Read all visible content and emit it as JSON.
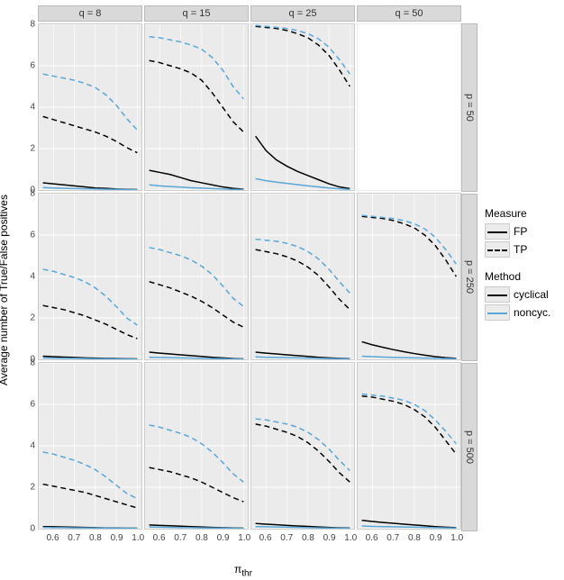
{
  "ylabel": "Average number of True/False positives",
  "xlabel": "π_thr",
  "x_ticks": [
    0.6,
    0.7,
    0.8,
    0.9,
    1.0
  ],
  "y_range": [
    0,
    8
  ],
  "y_ticks": [
    0,
    2,
    4,
    6,
    8
  ],
  "cols": [
    "q = 8",
    "q = 15",
    "q = 25",
    "q = 50"
  ],
  "rows": [
    "p = 50",
    "p = 250",
    "p = 500"
  ],
  "legend": {
    "measure_title": "Measure",
    "measure_items": [
      {
        "key": "FP",
        "label": "FP",
        "dash": false
      },
      {
        "key": "TP",
        "label": "TP",
        "dash": true
      }
    ],
    "method_title": "Method",
    "method_items": [
      {
        "key": "cyclical",
        "label": "cyclical",
        "color": "#000000"
      },
      {
        "key": "noncyc",
        "label": "noncyc.",
        "color": "#58a7d6"
      }
    ]
  },
  "chart_data": {
    "type": "line-grid",
    "x": [
      0.55,
      0.6,
      0.65,
      0.7,
      0.75,
      0.8,
      0.85,
      0.9,
      0.95,
      1.0
    ],
    "xlim": [
      0.53,
      1.02
    ],
    "ylim": [
      0,
      8
    ],
    "panels": [
      [
        {
          "q": 8,
          "p": 50,
          "series": [
            {
              "method": "cyclical",
              "measure": "TP",
              "y": [
                3.55,
                3.4,
                3.25,
                3.1,
                2.95,
                2.8,
                2.6,
                2.35,
                2.05,
                1.8
              ]
            },
            {
              "method": "noncyc",
              "measure": "TP",
              "y": [
                5.6,
                5.5,
                5.4,
                5.3,
                5.15,
                4.95,
                4.6,
                4.1,
                3.45,
                2.9
              ]
            },
            {
              "method": "cyclical",
              "measure": "FP",
              "y": [
                0.35,
                0.3,
                0.25,
                0.2,
                0.15,
                0.1,
                0.08,
                0.05,
                0.03,
                0.02
              ]
            },
            {
              "method": "noncyc",
              "measure": "FP",
              "y": [
                0.12,
                0.1,
                0.08,
                0.07,
                0.06,
                0.05,
                0.04,
                0.03,
                0.02,
                0.01
              ]
            }
          ]
        },
        {
          "q": 15,
          "p": 50,
          "series": [
            {
              "method": "cyclical",
              "measure": "TP",
              "y": [
                6.25,
                6.15,
                6.0,
                5.85,
                5.65,
                5.3,
                4.7,
                4.0,
                3.3,
                2.8
              ]
            },
            {
              "method": "noncyc",
              "measure": "TP",
              "y": [
                7.4,
                7.35,
                7.25,
                7.15,
                7.0,
                6.8,
                6.4,
                5.8,
                5.0,
                4.4
              ]
            },
            {
              "method": "cyclical",
              "measure": "FP",
              "y": [
                0.95,
                0.85,
                0.75,
                0.6,
                0.45,
                0.35,
                0.25,
                0.15,
                0.08,
                0.04
              ]
            },
            {
              "method": "noncyc",
              "measure": "FP",
              "y": [
                0.25,
                0.2,
                0.17,
                0.14,
                0.11,
                0.09,
                0.07,
                0.05,
                0.03,
                0.02
              ]
            }
          ]
        },
        {
          "q": 25,
          "p": 50,
          "series": [
            {
              "method": "cyclical",
              "measure": "TP",
              "y": [
                7.9,
                7.85,
                7.8,
                7.7,
                7.55,
                7.35,
                7.0,
                6.5,
                5.8,
                5.0
              ]
            },
            {
              "method": "noncyc",
              "measure": "TP",
              "y": [
                7.95,
                7.9,
                7.85,
                7.8,
                7.7,
                7.55,
                7.3,
                6.9,
                6.3,
                5.6
              ]
            },
            {
              "method": "cyclical",
              "measure": "FP",
              "y": [
                2.6,
                1.9,
                1.45,
                1.15,
                0.9,
                0.7,
                0.5,
                0.3,
                0.15,
                0.07
              ]
            },
            {
              "method": "noncyc",
              "measure": "FP",
              "y": [
                0.55,
                0.45,
                0.38,
                0.32,
                0.26,
                0.2,
                0.15,
                0.1,
                0.06,
                0.03
              ]
            }
          ]
        },
        {
          "q": 50,
          "p": 50,
          "blank": true
        }
      ],
      [
        {
          "q": 8,
          "p": 250,
          "series": [
            {
              "method": "cyclical",
              "measure": "TP",
              "y": [
                2.6,
                2.5,
                2.4,
                2.25,
                2.1,
                1.9,
                1.7,
                1.45,
                1.2,
                1.0
              ]
            },
            {
              "method": "noncyc",
              "measure": "TP",
              "y": [
                4.35,
                4.25,
                4.1,
                3.95,
                3.75,
                3.45,
                3.05,
                2.55,
                2.0,
                1.65
              ]
            },
            {
              "method": "cyclical",
              "measure": "FP",
              "y": [
                0.15,
                0.13,
                0.11,
                0.09,
                0.07,
                0.06,
                0.05,
                0.04,
                0.03,
                0.02
              ]
            },
            {
              "method": "noncyc",
              "measure": "FP",
              "y": [
                0.07,
                0.06,
                0.05,
                0.05,
                0.04,
                0.03,
                0.03,
                0.02,
                0.02,
                0.01
              ]
            }
          ]
        },
        {
          "q": 15,
          "p": 250,
          "series": [
            {
              "method": "cyclical",
              "measure": "TP",
              "y": [
                3.75,
                3.6,
                3.45,
                3.25,
                3.05,
                2.8,
                2.5,
                2.15,
                1.8,
                1.55
              ]
            },
            {
              "method": "noncyc",
              "measure": "TP",
              "y": [
                5.4,
                5.3,
                5.15,
                5.0,
                4.8,
                4.5,
                4.1,
                3.55,
                2.95,
                2.55
              ]
            },
            {
              "method": "cyclical",
              "measure": "FP",
              "y": [
                0.35,
                0.3,
                0.26,
                0.22,
                0.18,
                0.14,
                0.1,
                0.07,
                0.04,
                0.02
              ]
            },
            {
              "method": "noncyc",
              "measure": "FP",
              "y": [
                0.1,
                0.09,
                0.08,
                0.07,
                0.06,
                0.05,
                0.04,
                0.03,
                0.02,
                0.01
              ]
            }
          ]
        },
        {
          "q": 25,
          "p": 250,
          "series": [
            {
              "method": "cyclical",
              "measure": "TP",
              "y": [
                5.3,
                5.2,
                5.1,
                4.95,
                4.75,
                4.45,
                4.05,
                3.5,
                2.9,
                2.4
              ]
            },
            {
              "method": "noncyc",
              "measure": "TP",
              "y": [
                5.8,
                5.75,
                5.7,
                5.6,
                5.45,
                5.2,
                4.85,
                4.35,
                3.75,
                3.2
              ]
            },
            {
              "method": "cyclical",
              "measure": "FP",
              "y": [
                0.35,
                0.3,
                0.26,
                0.22,
                0.18,
                0.14,
                0.1,
                0.07,
                0.05,
                0.03
              ]
            },
            {
              "method": "noncyc",
              "measure": "FP",
              "y": [
                0.12,
                0.1,
                0.09,
                0.08,
                0.07,
                0.06,
                0.05,
                0.04,
                0.03,
                0.02
              ]
            }
          ]
        },
        {
          "q": 50,
          "p": 250,
          "series": [
            {
              "method": "cyclical",
              "measure": "TP",
              "y": [
                6.9,
                6.85,
                6.8,
                6.7,
                6.55,
                6.35,
                6.0,
                5.5,
                4.8,
                4.0
              ]
            },
            {
              "method": "noncyc",
              "measure": "TP",
              "y": [
                6.95,
                6.9,
                6.85,
                6.8,
                6.7,
                6.55,
                6.3,
                5.9,
                5.3,
                4.6
              ]
            },
            {
              "method": "cyclical",
              "measure": "FP",
              "y": [
                0.85,
                0.7,
                0.58,
                0.47,
                0.37,
                0.28,
                0.2,
                0.13,
                0.08,
                0.05
              ]
            },
            {
              "method": "noncyc",
              "measure": "FP",
              "y": [
                0.15,
                0.13,
                0.11,
                0.09,
                0.08,
                0.07,
                0.06,
                0.05,
                0.04,
                0.03
              ]
            }
          ]
        }
      ],
      [
        {
          "q": 8,
          "p": 500,
          "series": [
            {
              "method": "cyclical",
              "measure": "TP",
              "y": [
                2.15,
                2.05,
                1.95,
                1.85,
                1.75,
                1.6,
                1.45,
                1.3,
                1.15,
                1.0
              ]
            },
            {
              "method": "noncyc",
              "measure": "TP",
              "y": [
                3.7,
                3.6,
                3.45,
                3.3,
                3.1,
                2.85,
                2.5,
                2.1,
                1.7,
                1.45
              ]
            },
            {
              "method": "cyclical",
              "measure": "FP",
              "y": [
                0.1,
                0.09,
                0.08,
                0.07,
                0.06,
                0.05,
                0.04,
                0.03,
                0.02,
                0.02
              ]
            },
            {
              "method": "noncyc",
              "measure": "FP",
              "y": [
                0.06,
                0.05,
                0.05,
                0.04,
                0.04,
                0.03,
                0.03,
                0.02,
                0.02,
                0.01
              ]
            }
          ]
        },
        {
          "q": 15,
          "p": 500,
          "series": [
            {
              "method": "cyclical",
              "measure": "TP",
              "y": [
                2.95,
                2.85,
                2.75,
                2.6,
                2.45,
                2.25,
                2.0,
                1.75,
                1.5,
                1.3
              ]
            },
            {
              "method": "noncyc",
              "measure": "TP",
              "y": [
                5.0,
                4.9,
                4.75,
                4.6,
                4.4,
                4.1,
                3.7,
                3.2,
                2.65,
                2.25
              ]
            },
            {
              "method": "cyclical",
              "measure": "FP",
              "y": [
                0.18,
                0.16,
                0.14,
                0.12,
                0.1,
                0.08,
                0.06,
                0.05,
                0.03,
                0.02
              ]
            },
            {
              "method": "noncyc",
              "measure": "FP",
              "y": [
                0.08,
                0.07,
                0.06,
                0.05,
                0.05,
                0.04,
                0.03,
                0.03,
                0.02,
                0.01
              ]
            }
          ]
        },
        {
          "q": 25,
          "p": 500,
          "series": [
            {
              "method": "cyclical",
              "measure": "TP",
              "y": [
                5.05,
                4.95,
                4.8,
                4.65,
                4.45,
                4.15,
                3.75,
                3.25,
                2.7,
                2.25
              ]
            },
            {
              "method": "noncyc",
              "measure": "TP",
              "y": [
                5.3,
                5.25,
                5.15,
                5.05,
                4.9,
                4.65,
                4.3,
                3.85,
                3.3,
                2.8
              ]
            },
            {
              "method": "cyclical",
              "measure": "FP",
              "y": [
                0.25,
                0.22,
                0.19,
                0.16,
                0.13,
                0.11,
                0.08,
                0.06,
                0.04,
                0.03
              ]
            },
            {
              "method": "noncyc",
              "measure": "FP",
              "y": [
                0.1,
                0.09,
                0.08,
                0.07,
                0.06,
                0.05,
                0.04,
                0.03,
                0.02,
                0.02
              ]
            }
          ]
        },
        {
          "q": 50,
          "p": 500,
          "series": [
            {
              "method": "cyclical",
              "measure": "TP",
              "y": [
                6.4,
                6.35,
                6.25,
                6.15,
                6.0,
                5.75,
                5.4,
                4.9,
                4.25,
                3.6
              ]
            },
            {
              "method": "noncyc",
              "measure": "TP",
              "y": [
                6.5,
                6.45,
                6.4,
                6.3,
                6.2,
                6.0,
                5.7,
                5.25,
                4.7,
                4.1
              ]
            },
            {
              "method": "cyclical",
              "measure": "FP",
              "y": [
                0.4,
                0.35,
                0.3,
                0.26,
                0.22,
                0.18,
                0.14,
                0.1,
                0.07,
                0.05
              ]
            },
            {
              "method": "noncyc",
              "measure": "FP",
              "y": [
                0.13,
                0.11,
                0.1,
                0.09,
                0.08,
                0.07,
                0.06,
                0.05,
                0.04,
                0.03
              ]
            }
          ]
        }
      ]
    ]
  }
}
